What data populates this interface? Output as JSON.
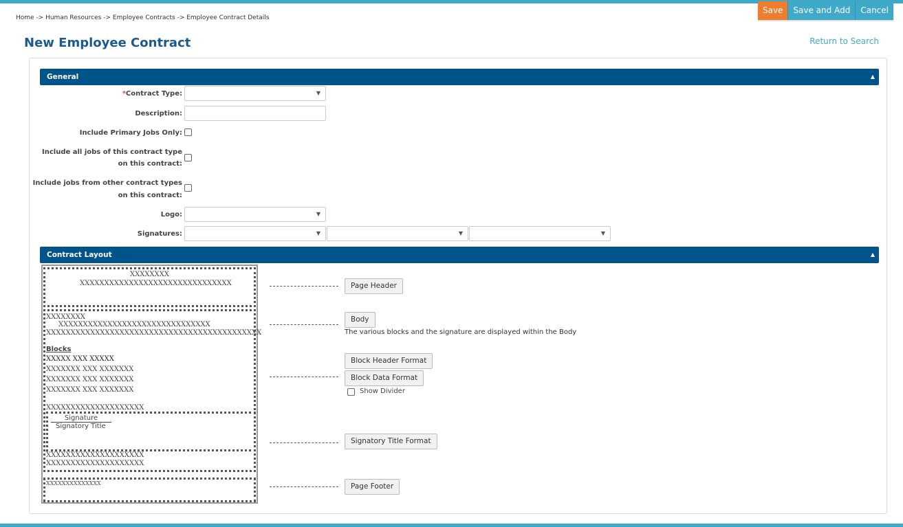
{
  "actions": {
    "save": "Save",
    "save_and_add": "Save and Add",
    "cancel": "Cancel"
  },
  "breadcrumb": "Home -> Human Resources -> Employee Contracts -> Employee Contract Details",
  "page_title": "New Employee Contract",
  "return_link": "Return to Search",
  "colors": {
    "accent": "#3fa9c9",
    "save": "#f07c2e",
    "header": "#00548a",
    "title": "#1a5a8c"
  },
  "general": {
    "title": "General",
    "contract_type_label": "Contract Type:",
    "required_mark": "*",
    "description_label": "Description:",
    "primary_jobs_label": "Include Primary Jobs Only:",
    "all_jobs_label_1": "Include all jobs of this contract type",
    "all_jobs_label_2": "on this contract:",
    "other_jobs_label_1": "Include jobs from other contract types",
    "other_jobs_label_2": "on this contract:",
    "logo_label": "Logo:",
    "signatures_label": "Signatures:"
  },
  "layout": {
    "title": "Contract Layout",
    "preview": {
      "header_1": "XXXXXXXX",
      "header_2": "XXXXXXXXXXXXXXXXXXXXXXXXXXXXXXX",
      "body_1": "XXXXXXXX",
      "body_2": "XXXXXXXXXXXXXXXXXXXXXXXXXXXXXXX",
      "body_3": "XXXXXXXXXXXXXXXXXXXXXXXXXXXXXXXXXXXXXXXXXXXX",
      "blocks_title": "Blocks",
      "blocks_header": "XXXXX    XXX XXXXX",
      "block_row_1": "XXXXXXX XXX XXXXXXX",
      "block_row_2": "XXXXXXX XXX XXXXXXX",
      "block_row_3": "XXXXXXX XXX XXXXXXX",
      "body_4": "XXXXXXXXXXXXXXXXXXXX",
      "signature": "Signature",
      "signatory_title": "Signatory Title",
      "body_5": "XXXXXXXXXXXXXXXXXXXX",
      "body_6": "XXXXXXXXXXXXXXXXXXXX",
      "footer": "XXXXXXXXXXXXXX"
    },
    "page_header_button": "Page Header",
    "body_button": "Body",
    "body_note": "The various blocks and the signature are displayed within the Body",
    "block_header_button": "Block Header Format",
    "block_data_button": "Block Data Format",
    "show_divider_label": "Show Divider",
    "signatory_button": "Signatory Title Format",
    "page_footer_button": "Page Footer"
  }
}
